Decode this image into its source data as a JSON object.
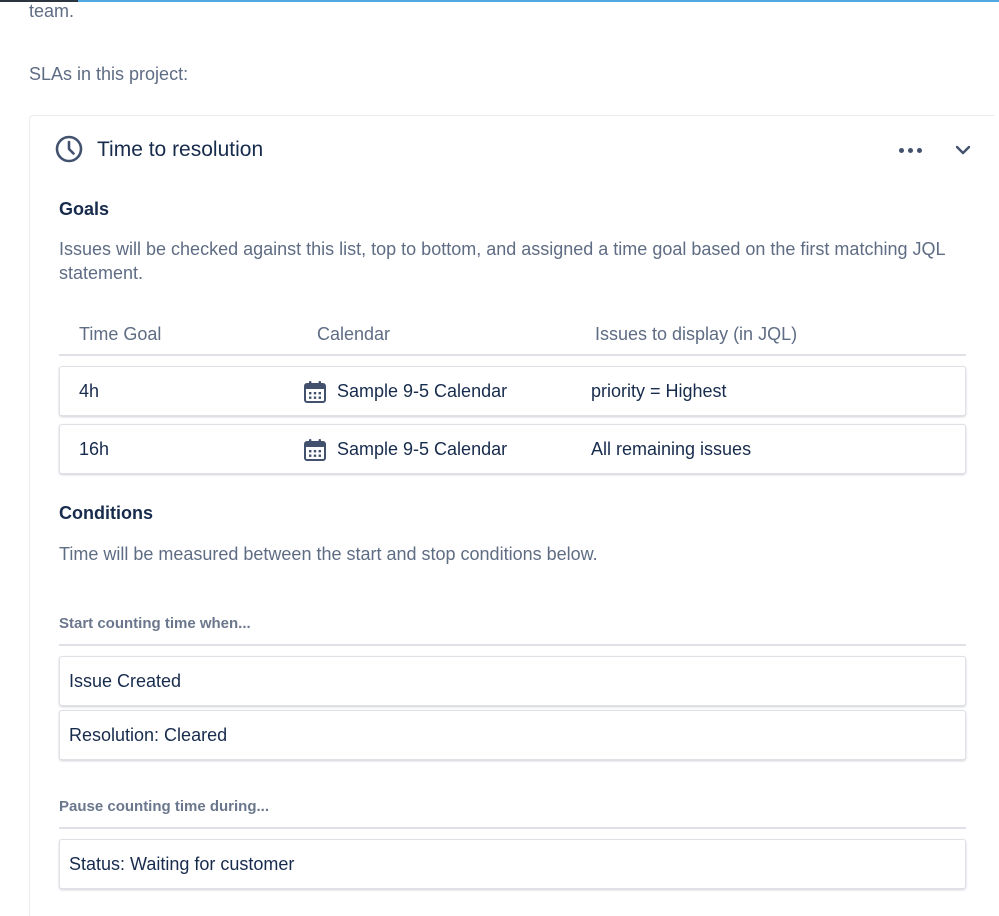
{
  "intro": {
    "trailing_text": "team.",
    "slas_label": "SLAs in this project:"
  },
  "sla": {
    "title": "Time to resolution",
    "icons": {
      "clock": "clock-icon",
      "more": "more-icon",
      "chevron": "chevron-down-icon",
      "calendar": "calendar-icon"
    },
    "goals": {
      "heading": "Goals",
      "description": "Issues will be checked against this list, top to bottom, and assigned a time goal based on the first matching JQL statement.",
      "columns": [
        "Time Goal",
        "Calendar",
        "Issues to display (in JQL)"
      ],
      "rows": [
        {
          "time_goal": "4h",
          "calendar": "Sample 9-5 Calendar",
          "jql": "priority = Highest"
        },
        {
          "time_goal": "16h",
          "calendar": "Sample 9-5 Calendar",
          "jql": "All remaining issues"
        }
      ]
    },
    "conditions": {
      "heading": "Conditions",
      "description": "Time will be measured between the start and stop conditions below.",
      "start_label": "Start counting time when...",
      "start_items": [
        "Issue Created",
        "Resolution: Cleared"
      ],
      "pause_label": "Pause counting time during...",
      "pause_items": [
        "Status: Waiting for customer"
      ]
    }
  },
  "colors": {
    "accent_bar": "#4fa8e0",
    "heading_text": "#172b4d",
    "muted_text": "#5e6c84",
    "border": "#dfe1e6"
  }
}
